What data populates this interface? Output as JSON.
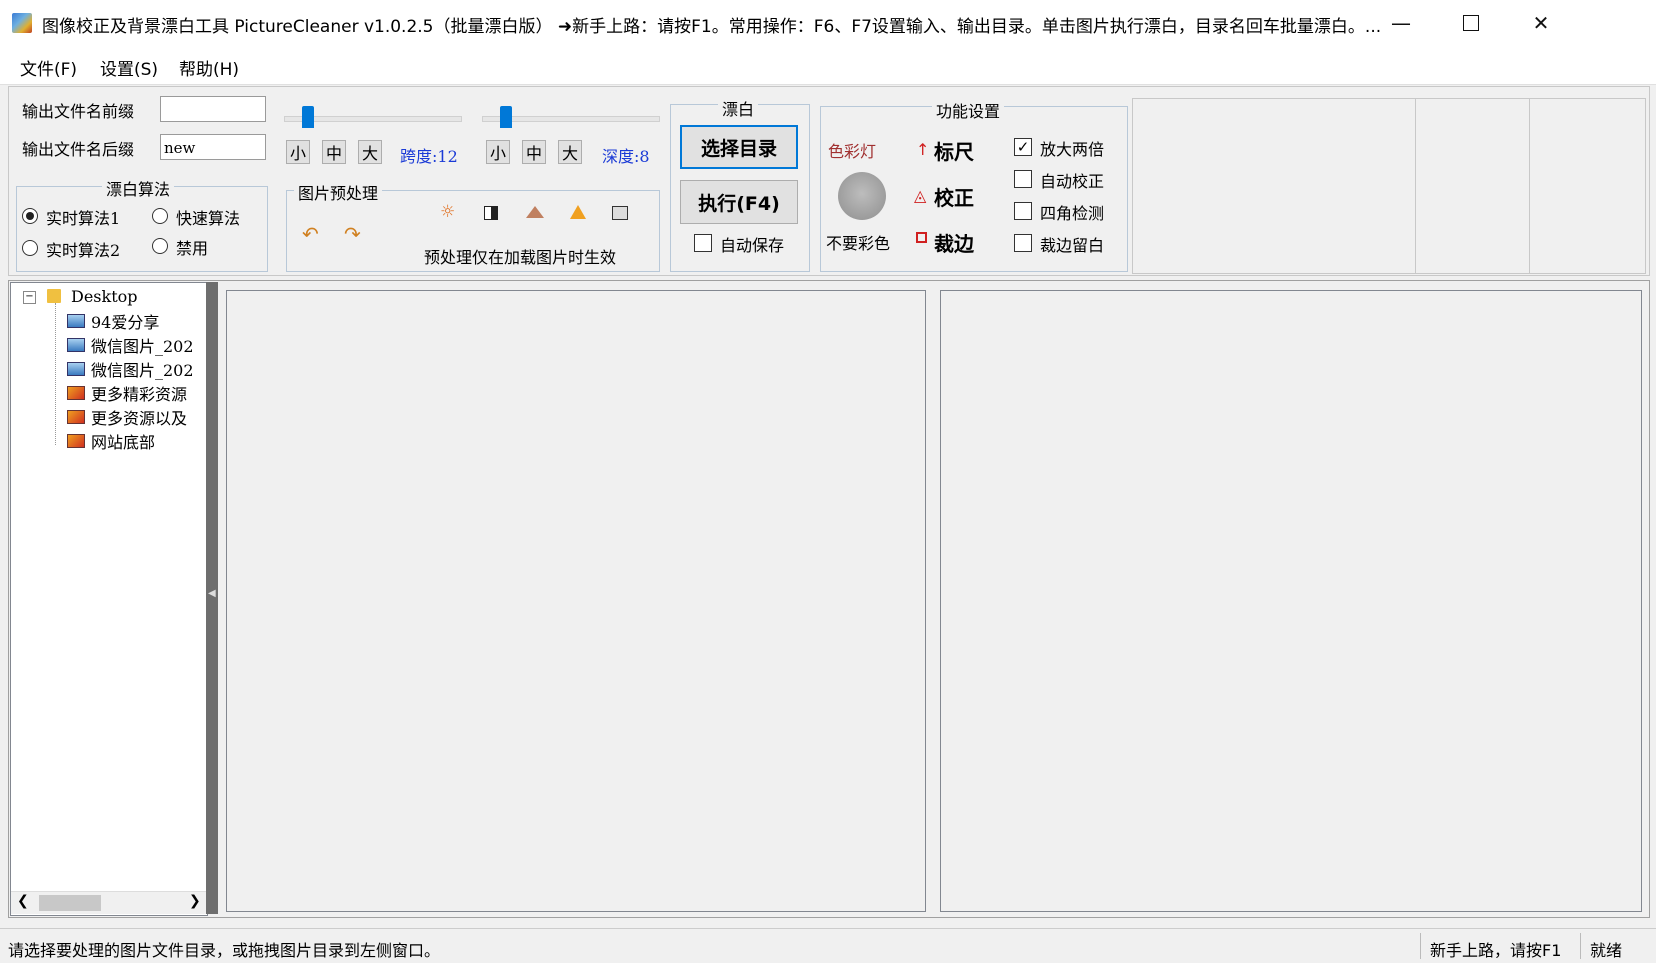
{
  "window": {
    "title": "图像校正及背景漂白工具 PictureCleaner v1.0.2.5（批量漂白版）  ➜新手上路：请按F1。常用操作：F6、F7设置输入、输出目录。单击图片执行漂白，目录名回车批量漂白。..."
  },
  "menu": [
    "文件(F)",
    "设置(S)",
    "帮助(H)"
  ],
  "output": {
    "prefix_label": "输出文件名前缀",
    "prefix_value": "",
    "suffix_label": "输出文件名后缀",
    "suffix_value": "new"
  },
  "span_slider": {
    "buttons": [
      "小",
      "中",
      "大"
    ],
    "readout": "跨度:12",
    "level": 12
  },
  "depth_slider": {
    "buttons": [
      "小",
      "中",
      "大"
    ],
    "readout": "深度:8",
    "level": 8
  },
  "algorithm": {
    "title": "漂白算法",
    "options": [
      "实时算法1",
      "快速算法",
      "实时算法2",
      "禁用"
    ],
    "selected": "实时算法1"
  },
  "preprocess": {
    "title": "图片预处理",
    "note": "预处理仅在加载图片时生效",
    "icons": [
      "undo-icon",
      "redo-icon",
      "brightness-icon",
      "contrast-icon",
      "levels-icon",
      "sharpen-icon",
      "resize-icon"
    ]
  },
  "bleach": {
    "title": "漂白",
    "select_dir": "选择目录",
    "execute": "执行(F4)",
    "autosave_label": "自动保存",
    "autosave_checked": false
  },
  "features": {
    "title": "功能设置",
    "color_light": "色彩灯",
    "no_color": "不要彩色",
    "ruler": "标尺",
    "correct": "校正",
    "crop": "裁边",
    "checks": [
      {
        "label": "放大两倍",
        "checked": true
      },
      {
        "label": "自动校正",
        "checked": false
      },
      {
        "label": "四角检测",
        "checked": false
      },
      {
        "label": "裁边留白",
        "checked": false
      }
    ]
  },
  "tree": {
    "root": "Desktop",
    "items": [
      "94爱分享",
      "微信图片_202",
      "微信图片_202",
      "更多精彩资源",
      "更多资源以及",
      "网站底部"
    ]
  },
  "status": {
    "message": "请选择要处理的图片文件目录，或拖拽图片目录到左侧窗口。",
    "hint": "新手上路，请按F1",
    "state": "就绪"
  },
  "colors": {
    "accent": "#0078d7",
    "readout": "#1a3ad6",
    "color_light_text": "#a03030",
    "tool_red": "#d02020"
  }
}
